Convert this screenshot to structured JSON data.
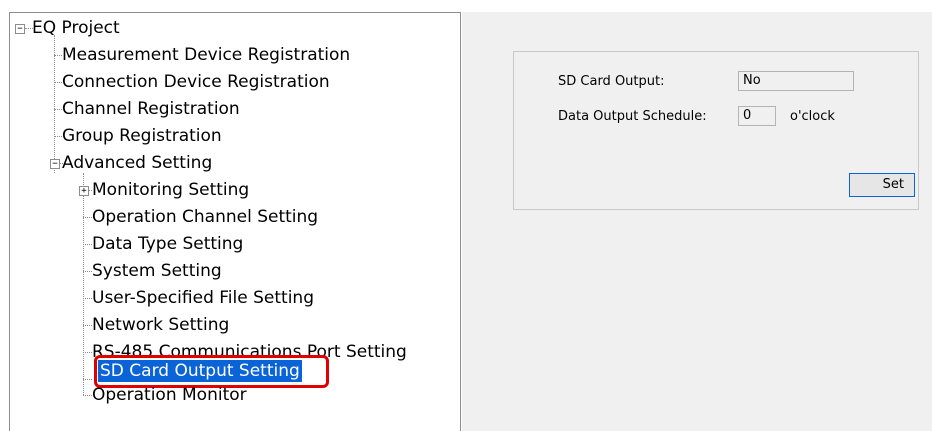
{
  "tree": {
    "root": "EQ Project",
    "items": [
      "Measurement Device Registration",
      "Connection Device Registration",
      "Channel Registration",
      "Group Registration",
      "Advanced Setting"
    ],
    "advanced": [
      "Monitoring Setting",
      "Operation Channel Setting",
      "Data Type Setting",
      "System Setting",
      "User-Specified File Setting",
      "Network Setting",
      "RS-485 Communications Port Setting",
      "SD Card Output Setting",
      "Operation Monitor"
    ],
    "expander_collapse": "−",
    "expander_expand": "+"
  },
  "form": {
    "sd_label": "SD Card Output:",
    "sd_value": "No",
    "schedule_label": "Data Output Schedule:",
    "schedule_value": "0",
    "schedule_unit": "o'clock",
    "set_label": "Set"
  },
  "colors": {
    "selection": "#0a64d8",
    "highlight": "#e00000"
  }
}
